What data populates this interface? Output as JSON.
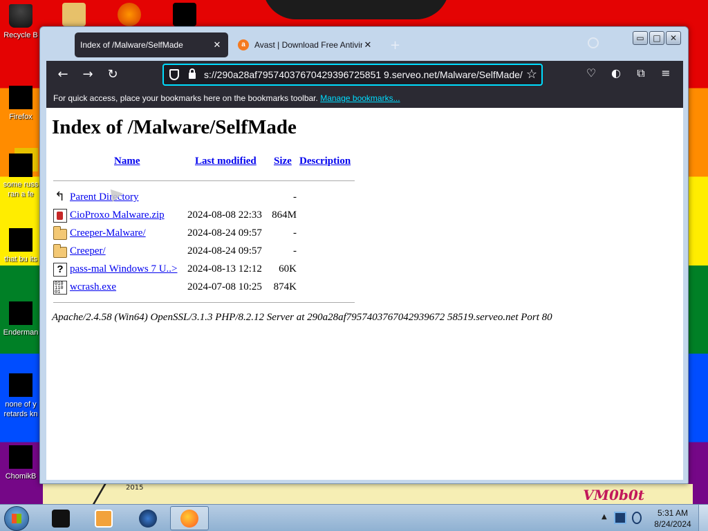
{
  "desktop": {
    "icons": [
      {
        "label": "Recycle B"
      },
      {
        "label": "Firefox"
      },
      {
        "label": "some russ",
        "label2": "ran a fe"
      },
      {
        "label": "that bu its"
      },
      {
        "label": "Enderman"
      },
      {
        "label": "none of y",
        "label2": "retards kn"
      },
      {
        "label": "ChomikB"
      }
    ],
    "wallpaper_year": "2015",
    "wallpaper_signature": "VM0b0t"
  },
  "browser": {
    "tabs": [
      {
        "title": "Index of /Malware/SelfMade",
        "close": "✕",
        "active": true
      },
      {
        "title": "Avast | Download Free Antiviru",
        "close": "✕",
        "active": false
      }
    ],
    "new_tab": "+",
    "window_buttons": {
      "minimize": "▭",
      "maximize": "□",
      "close": "✕"
    },
    "nav": {
      "back": "←",
      "forward": "→",
      "reload": "↻"
    },
    "url": "s://290a28af79574037670429396725851 9.serveo.net/Malware/SelfMade/",
    "bookmark_star": "☆",
    "toolbar_icons": {
      "pocket": "♡",
      "account": "◐",
      "extensions": "⧉",
      "menu": "≡"
    },
    "bookmarks_bar": {
      "text": "For quick access, place your bookmarks here on the bookmarks toolbar.",
      "link": "Manage bookmarks..."
    }
  },
  "page": {
    "heading": "Index of /Malware/SelfMade",
    "columns": {
      "name": "Name",
      "last_modified": "Last modified",
      "size": "Size",
      "description": "Description"
    },
    "rows": [
      {
        "icon": "back-icon",
        "name": "Parent Directory",
        "date": "",
        "size": "-"
      },
      {
        "icon": "zip-file-icon",
        "name": "CioProxo Malware.zip",
        "date": "2024-08-08 22:33",
        "size": "864M"
      },
      {
        "icon": "folder-icon",
        "name": "Creeper-Malware/",
        "date": "2024-08-24 09:57",
        "size": "-"
      },
      {
        "icon": "folder-icon",
        "name": "Creeper/",
        "date": "2024-08-24 09:57",
        "size": "-"
      },
      {
        "icon": "unknown-file-icon",
        "name": "pass-mal Windows 7 U..>",
        "date": "2024-08-13 12:12",
        "size": "60K"
      },
      {
        "icon": "binary-file-icon",
        "name": "wcrash.exe",
        "date": "2024-07-08 10:25",
        "size": "874K"
      }
    ],
    "footer": "Apache/2.4.58 (Win64) OpenSSL/3.1.3 PHP/8.2.12 Server at 290a28af7957403767042939672 58519.serveo.net Port 80"
  },
  "taskbar": {
    "clock_time": "5:31 AM",
    "clock_date": "8/24/2024",
    "tray_arrow": "▲"
  }
}
